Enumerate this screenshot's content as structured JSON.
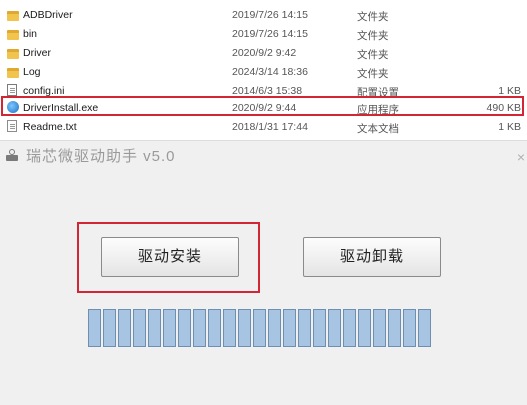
{
  "files": [
    {
      "name": "ADBDriver",
      "date": "2019/7/26 14:15",
      "type": "文件夹",
      "size": "",
      "icon": "folder-icon"
    },
    {
      "name": "bin",
      "date": "2019/7/26 14:15",
      "type": "文件夹",
      "size": "",
      "icon": "folder-icon"
    },
    {
      "name": "Driver",
      "date": "2020/9/2 9:42",
      "type": "文件夹",
      "size": "",
      "icon": "folder-icon"
    },
    {
      "name": "Log",
      "date": "2024/3/14 18:36",
      "type": "文件夹",
      "size": "",
      "icon": "folder-icon"
    },
    {
      "name": "config.ini",
      "date": "2014/6/3 15:38",
      "type": "配置设置",
      "size": "1 KB",
      "icon": "config-file-icon"
    },
    {
      "name": "DriverInstall.exe",
      "date": "2020/9/2 9:44",
      "type": "应用程序",
      "size": "490 KB",
      "icon": "app-icon"
    },
    {
      "name": "Readme.txt",
      "date": "2018/1/31 17:44",
      "type": "文本文档",
      "size": "1 KB",
      "icon": "text-file-icon"
    }
  ],
  "installer": {
    "title": "瑞芯微驱动助手 v5.0",
    "close_hint": "×",
    "install_label": "驱动安装",
    "uninstall_label": "驱动卸载",
    "progress_segments": 23
  },
  "colors": {
    "highlight": "#d32634",
    "progress": "#a7c4e2"
  }
}
